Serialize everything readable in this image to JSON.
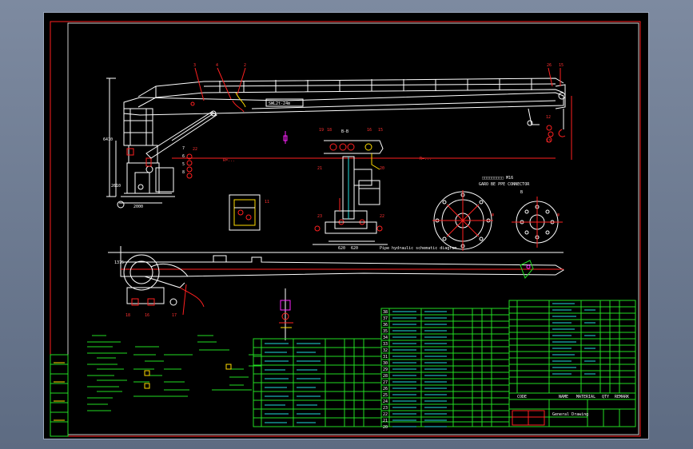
{
  "drawing": {
    "boom_label": "SWL2t-24m",
    "pipe_title": "Pipe hydraulic  schematic diagram",
    "section_label": "B-B"
  },
  "balloons": {
    "top": [
      "3",
      "4",
      "2",
      "26",
      "15"
    ],
    "right": [
      "12",
      "13"
    ],
    "mid": [
      "22"
    ],
    "bottom": [
      "18",
      "16",
      "17"
    ]
  },
  "colors": {
    "line": "#ffffff",
    "dim": "#ff2020",
    "table": "#22dd22",
    "text": "#22dddd",
    "accent": "#ff22ff"
  },
  "parts_table": {
    "rows": [
      "38",
      "37",
      "36",
      "35",
      "34",
      "33",
      "32",
      "31",
      "30",
      "29",
      "28",
      "27",
      "26",
      "25",
      "24",
      "23",
      "22",
      "21",
      "20"
    ]
  },
  "title_block": {
    "headers": [
      "CODE",
      "NAME",
      "MATERIAL",
      "QTY",
      "REMARK"
    ],
    "drawing_title": "General Drawing"
  }
}
